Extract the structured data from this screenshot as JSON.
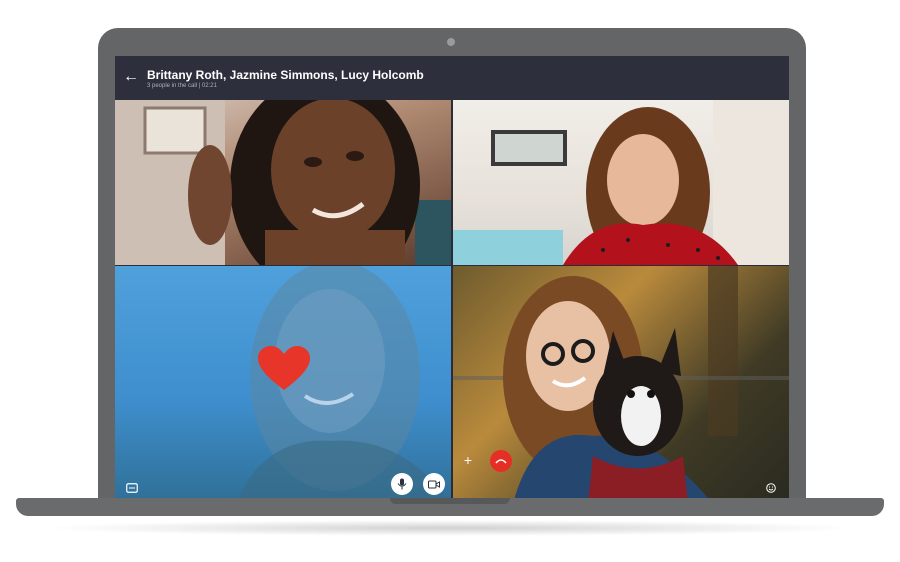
{
  "call": {
    "title": "Brittany Roth, Jazmine Simmons, Lucy Holcomb",
    "subtitle": "3 people in the call | 02:21"
  },
  "colors": {
    "header_bg": "#2d2f3c",
    "end_call": "#e52f25",
    "heart": "#e8352a",
    "laptop": "#646566"
  },
  "icons": {
    "back": "arrow-left",
    "chat": "chat",
    "mic": "microphone",
    "video": "video-camera",
    "add": "plus",
    "end_call": "phone-hangup",
    "emoji": "smiley",
    "gallery": "image"
  },
  "video_tiles": [
    {
      "id": "tile-1",
      "content": "photo"
    },
    {
      "id": "tile-2",
      "content": "photo"
    },
    {
      "id": "tile-3",
      "content": "photo-with-heart-reaction"
    },
    {
      "id": "tile-4",
      "content": "photo"
    }
  ]
}
